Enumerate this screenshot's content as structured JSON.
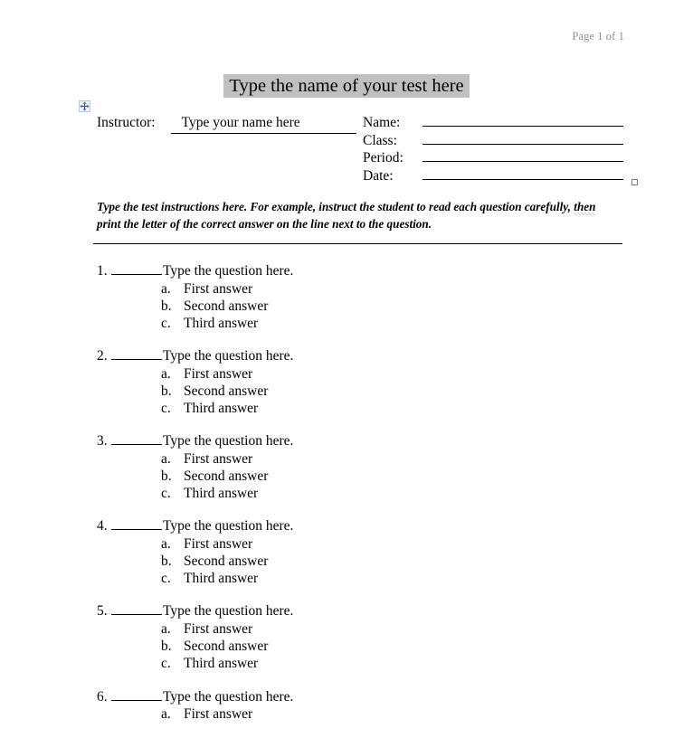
{
  "header": {
    "page_indicator": "Page 1 of 1"
  },
  "document": {
    "title": "Type the name of your test here",
    "title_highlight_color": "#c0c0c0"
  },
  "info_table": {
    "move_handle_icon": "move-four-arrows-icon",
    "resize_handle_icon": "resize-handle-icon",
    "instructor": {
      "label": "Instructor:",
      "value": "Type your name here"
    },
    "student_fields": [
      {
        "label": "Name:",
        "value": ""
      },
      {
        "label": "Class:",
        "value": ""
      },
      {
        "label": "Period:",
        "value": ""
      },
      {
        "label": "Date:",
        "value": ""
      }
    ]
  },
  "instructions": {
    "part1": "Type the test instructions here.  For example, instruct the student to read each question carefully, ",
    "flagged_word": "then",
    "part2": " print the letter of the correct answer on the line next to the question."
  },
  "questions": [
    {
      "number": "1.",
      "text": "Type the question here.",
      "answers": [
        {
          "letter": "a.",
          "text": "First answer"
        },
        {
          "letter": "b.",
          "text": "Second answer"
        },
        {
          "letter": "c.",
          "text": "Third answer"
        }
      ]
    },
    {
      "number": "2.",
      "text": "Type the question here.",
      "answers": [
        {
          "letter": "a.",
          "text": "First answer"
        },
        {
          "letter": "b.",
          "text": "Second answer"
        },
        {
          "letter": "c.",
          "text": "Third answer"
        }
      ]
    },
    {
      "number": "3.",
      "text": "Type the question here.",
      "answers": [
        {
          "letter": "a.",
          "text": "First answer"
        },
        {
          "letter": "b.",
          "text": "Second answer"
        },
        {
          "letter": "c.",
          "text": "Third answer"
        }
      ]
    },
    {
      "number": "4.",
      "text": "Type the question here.",
      "answers": [
        {
          "letter": "a.",
          "text": "First answer"
        },
        {
          "letter": "b.",
          "text": "Second answer"
        },
        {
          "letter": "c.",
          "text": "Third answer"
        }
      ]
    },
    {
      "number": "5.",
      "text": "Type the question here.",
      "answers": [
        {
          "letter": "a.",
          "text": "First answer"
        },
        {
          "letter": "b.",
          "text": "Second answer"
        },
        {
          "letter": "c.",
          "text": "Third answer"
        }
      ]
    },
    {
      "number": "6.",
      "text": "Type the question here.",
      "answers": [
        {
          "letter": "a.",
          "text": "First answer"
        }
      ]
    }
  ]
}
